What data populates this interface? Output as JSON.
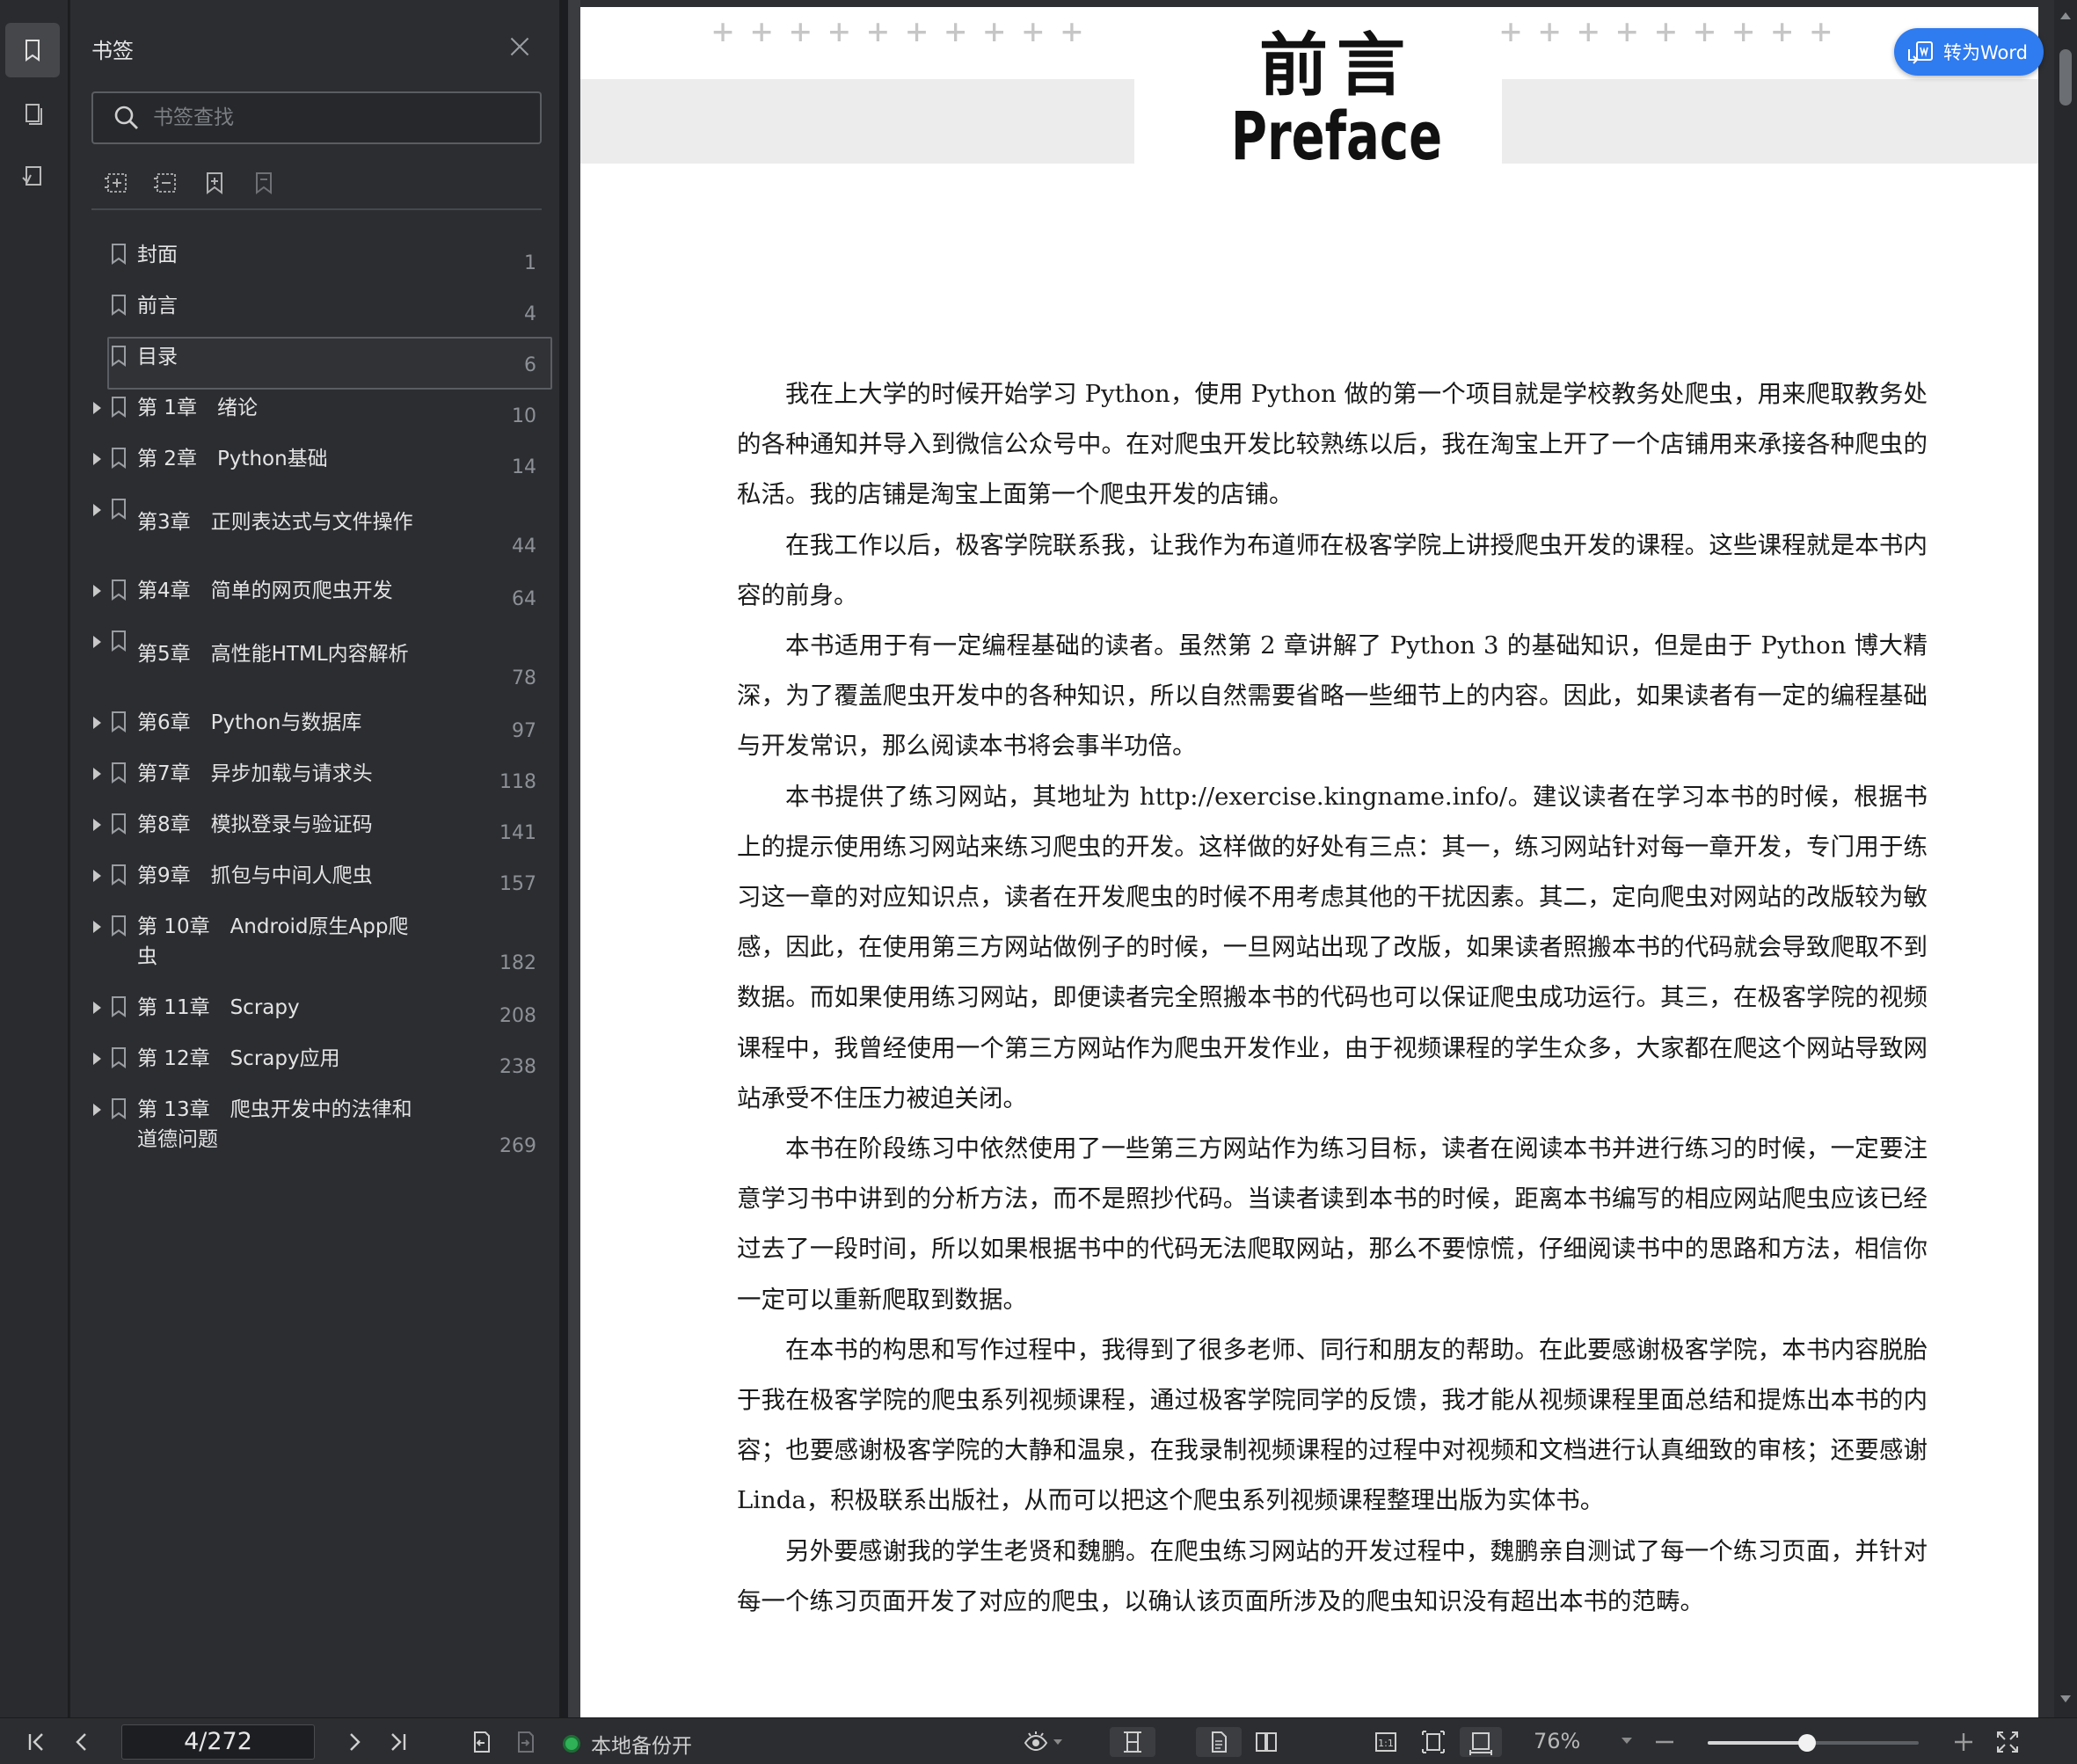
{
  "sidebar": {
    "title": "书签",
    "search_placeholder": "书签查找",
    "items": [
      {
        "label": "封面",
        "page": "1",
        "expandable": false
      },
      {
        "label": "前言",
        "page": "4",
        "expandable": false
      },
      {
        "label": "目录",
        "page": "6",
        "expandable": false,
        "selected": true
      },
      {
        "label": "第 1章　绪论",
        "page": "10",
        "expandable": true
      },
      {
        "label": "第 2章　Python基础",
        "page": "14",
        "expandable": true
      },
      {
        "label": "第3章　正则表达式与文件操作",
        "page": "44",
        "expandable": true
      },
      {
        "label": "第4章　简单的网页爬虫开发",
        "page": "64",
        "expandable": true
      },
      {
        "label": "第5章　高性能HTML内容解析",
        "page": "78",
        "expandable": true
      },
      {
        "label": "第6章　Python与数据库",
        "page": "97",
        "expandable": true
      },
      {
        "label": "第7章　异步加载与请求头",
        "page": "118",
        "expandable": true
      },
      {
        "label": "第8章　模拟登录与验证码",
        "page": "141",
        "expandable": true
      },
      {
        "label": "第9章　抓包与中间人爬虫",
        "page": "157",
        "expandable": true
      },
      {
        "label": "第 10章　Android原生App爬\n虫",
        "page": "182",
        "expandable": true
      },
      {
        "label": "第 11章　Scrapy",
        "page": "208",
        "expandable": true
      },
      {
        "label": "第 12章　Scrapy应用",
        "page": "238",
        "expandable": true
      },
      {
        "label": "第 13章　爬虫开发中的法律和\n道德问题",
        "page": "269",
        "expandable": true
      }
    ]
  },
  "document": {
    "title_cn": "前言",
    "title_en": "Preface",
    "to_word_label": "转为Word",
    "paragraphs": [
      "我在上大学的时候开始学习 Python，使用 Python 做的第一个项目就是学校教务处爬虫，用来爬取教务处的各种通知并导入到微信公众号中。在对爬虫开发比较熟练以后，我在淘宝上开了一个店铺用来承接各种爬虫的私活。我的店铺是淘宝上面第一个爬虫开发的店铺。",
      "在我工作以后，极客学院联系我，让我作为布道师在极客学院上讲授爬虫开发的课程。这些课程就是本书内容的前身。",
      "本书适用于有一定编程基础的读者。虽然第 2 章讲解了 Python 3 的基础知识，但是由于 Python 博大精深，为了覆盖爬虫开发中的各种知识，所以自然需要省略一些细节上的内容。因此，如果读者有一定的编程基础与开发常识，那么阅读本书将会事半功倍。",
      "本书提供了练习网站，其地址为 http://exercise.kingname.info/。建议读者在学习本书的时候，根据书上的提示使用练习网站来练习爬虫的开发。这样做的好处有三点：其一，练习网站针对每一章开发，专门用于练习这一章的对应知识点，读者在开发爬虫的时候不用考虑其他的干扰因素。其二，定向爬虫对网站的改版较为敏感，因此，在使用第三方网站做例子的时候，一旦网站出现了改版，如果读者照搬本书的代码就会导致爬取不到数据。而如果使用练习网站，即便读者完全照搬本书的代码也可以保证爬虫成功运行。其三，在极客学院的视频课程中，我曾经使用一个第三方网站作为爬虫开发作业，由于视频课程的学生众多，大家都在爬这个网站导致网站承受不住压力被迫关闭。",
      "本书在阶段练习中依然使用了一些第三方网站作为练习目标，读者在阅读本书并进行练习的时候，一定要注意学习书中讲到的分析方法，而不是照抄代码。当读者读到本书的时候，距离本书编写的相应网站爬虫应该已经过去了一段时间，所以如果根据书中的代码无法爬取网站，那么不要惊慌，仔细阅读书中的思路和方法，相信你一定可以重新爬取到数据。",
      "在本书的构思和写作过程中，我得到了很多老师、同行和朋友的帮助。在此要感谢极客学院，本书内容脱胎于我在极客学院的爬虫系列视频课程，通过极客学院同学的反馈，我才能从视频课程里面总结和提炼出本书的内容；也要感谢极客学院的大静和温泉，在我录制视频课程的过程中对视频和文档进行认真细致的审核；还要感谢 Linda，积极联系出版社，从而可以把这个爬虫系列视频课程整理出版为实体书。",
      "另外要感谢我的学生老贤和魏鹏。在爬虫练习网站的开发过程中，魏鹏亲自测试了每一个练习页面，并针对每一个练习页面开发了对应的爬虫，以确认该页面所涉及的爬虫知识没有超出本书的范畴。"
    ]
  },
  "statusbar": {
    "page_indicator": "4/272",
    "backup_label": "本地备份开",
    "zoom_label": "76%",
    "zoom_fraction": 0.76
  },
  "icons": {
    "rail": [
      "bookmark-icon",
      "page-thumbnails-icon",
      "annotation-icon"
    ],
    "toolbar": [
      "expand-all-icon",
      "collapse-all-icon",
      "add-bookmark-icon",
      "remove-bookmark-icon"
    ]
  }
}
